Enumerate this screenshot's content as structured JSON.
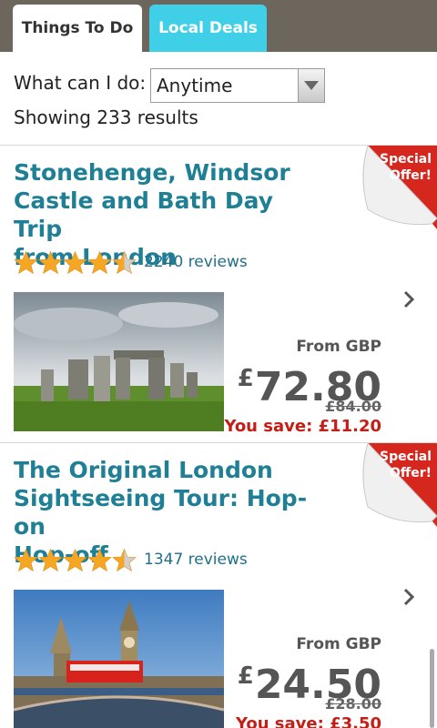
{
  "tabs": [
    {
      "label": "Things To Do",
      "active": true
    },
    {
      "label": "Local Deals",
      "active": false
    }
  ],
  "filter": {
    "label": "What can I do:",
    "selected": "Anytime"
  },
  "results_text": "Showing 233 results",
  "listings": [
    {
      "title_lines": [
        "Stonehenge, Windsor",
        "Castle and Bath Day Trip",
        "from London"
      ],
      "rating": 4.5,
      "reviews": "2240 reviews",
      "badge_lines": [
        "Special",
        "Offer!"
      ],
      "from_label": "From GBP",
      "price_currency": "£",
      "price_value": "72.80",
      "old_price": "£84.00",
      "save_text": "You save: £11.20",
      "photo_icon": "stonehenge-photo"
    },
    {
      "title_lines": [
        "The Original London",
        "Sightseeing Tour: Hop-on",
        "Hop-off"
      ],
      "rating": 4.5,
      "reviews": "1347 reviews",
      "badge_lines": [
        "Special",
        "Offer!"
      ],
      "from_label": "From GBP",
      "price_currency": "£",
      "price_value": "24.50",
      "old_price": "£28.00",
      "save_text": "You save: £3.50",
      "photo_icon": "london-bridge-bus-photo"
    }
  ],
  "colors": {
    "tabbar": "#6c665c",
    "deals_tab": "#3fd0e8",
    "title": "#1f7f95",
    "star": "#f5a623",
    "save": "#c41e16",
    "badge": "#d6271f"
  }
}
